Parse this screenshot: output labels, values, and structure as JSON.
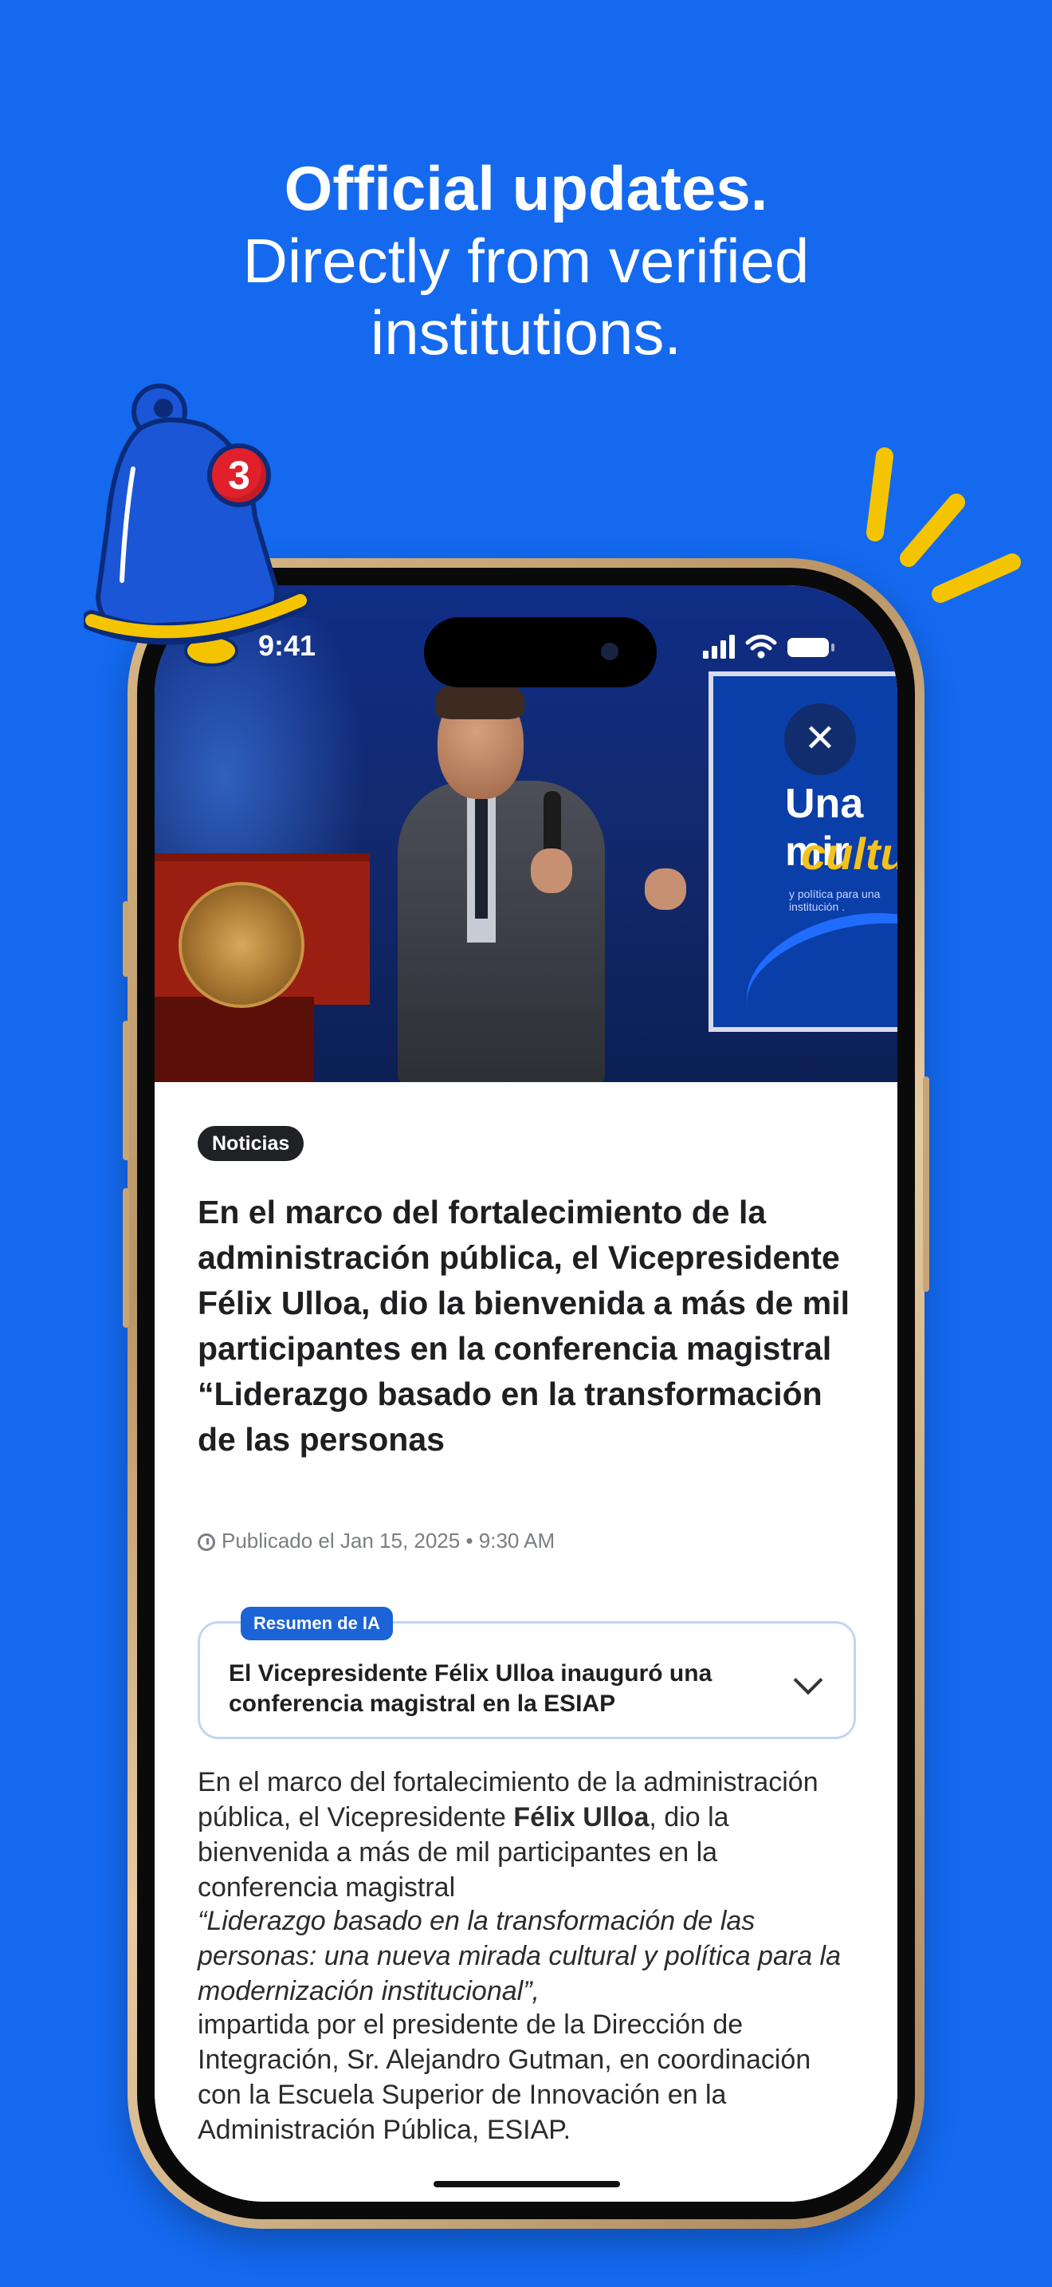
{
  "promo": {
    "headline_bold": "Official updates.",
    "headline_line2": "Directly from verified",
    "headline_line3": "institutions.",
    "bell_badge_count": "3",
    "bell_icon": "bell-icon",
    "colors": {
      "background": "#1469ef",
      "accent_yellow": "#f5c400",
      "badge_red": "#e0202a"
    }
  },
  "status_bar": {
    "time": "9:41",
    "icons": [
      "signal-icon",
      "wifi-icon",
      "battery-icon"
    ]
  },
  "hero": {
    "close_icon": "close-icon",
    "screen_text_1": "Una mir",
    "screen_text_2": "cultur",
    "screen_text_3": "y política para una institución ."
  },
  "article": {
    "category": "Noticias",
    "title": "En el marco del fortalecimiento de la administración pública, el Vicepresidente Félix Ulloa, dio la bienvenida a más de mil participantes en la conferencia magistral “Liderazgo basado en la transformación de las personas",
    "published": "Publicado el Jan 15, 2025 • 9:30 AM",
    "ai_summary_label": "Resumen de IA",
    "ai_summary_text": "El Vicepresidente Félix Ulloa inauguró una conferencia magistral en la ESIAP",
    "p1_before": "En el marco del fortalecimiento de la administración pública, el Vicepresidente ",
    "p1_bold": "Félix Ulloa",
    "p1_after": ", dio la bienvenida a más de mil participantes en la conferencia magistral",
    "p2": "“Liderazgo basado en la transformación de las personas: una nueva mirada cultural y política para la modernización institucional”,",
    "p3": "impartida por el presidente de la Dirección de Integración, Sr. Alejandro Gutman, en coordinación con la Escuela Superior de Innovación en la Administración Pública, ESIAP."
  }
}
